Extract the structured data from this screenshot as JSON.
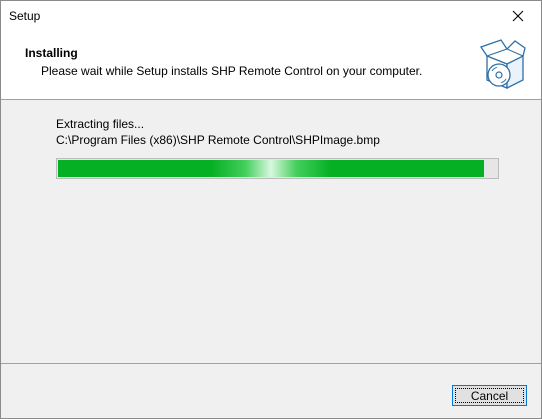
{
  "window": {
    "title": "Setup"
  },
  "header": {
    "title": "Installing",
    "subtitle": "Please wait while Setup installs SHP Remote Control on your computer."
  },
  "content": {
    "status": "Extracting files...",
    "path": "C:\\Program Files (x86)\\SHP Remote Control\\SHPImage.bmp",
    "progress_fraction": 0.97
  },
  "footer": {
    "cancel_label": "Cancel"
  },
  "icons": {
    "close": "close-icon",
    "header": "install-box-cd-icon"
  },
  "colors": {
    "progress_green": "#06b025",
    "button_border": "#0078d7"
  }
}
